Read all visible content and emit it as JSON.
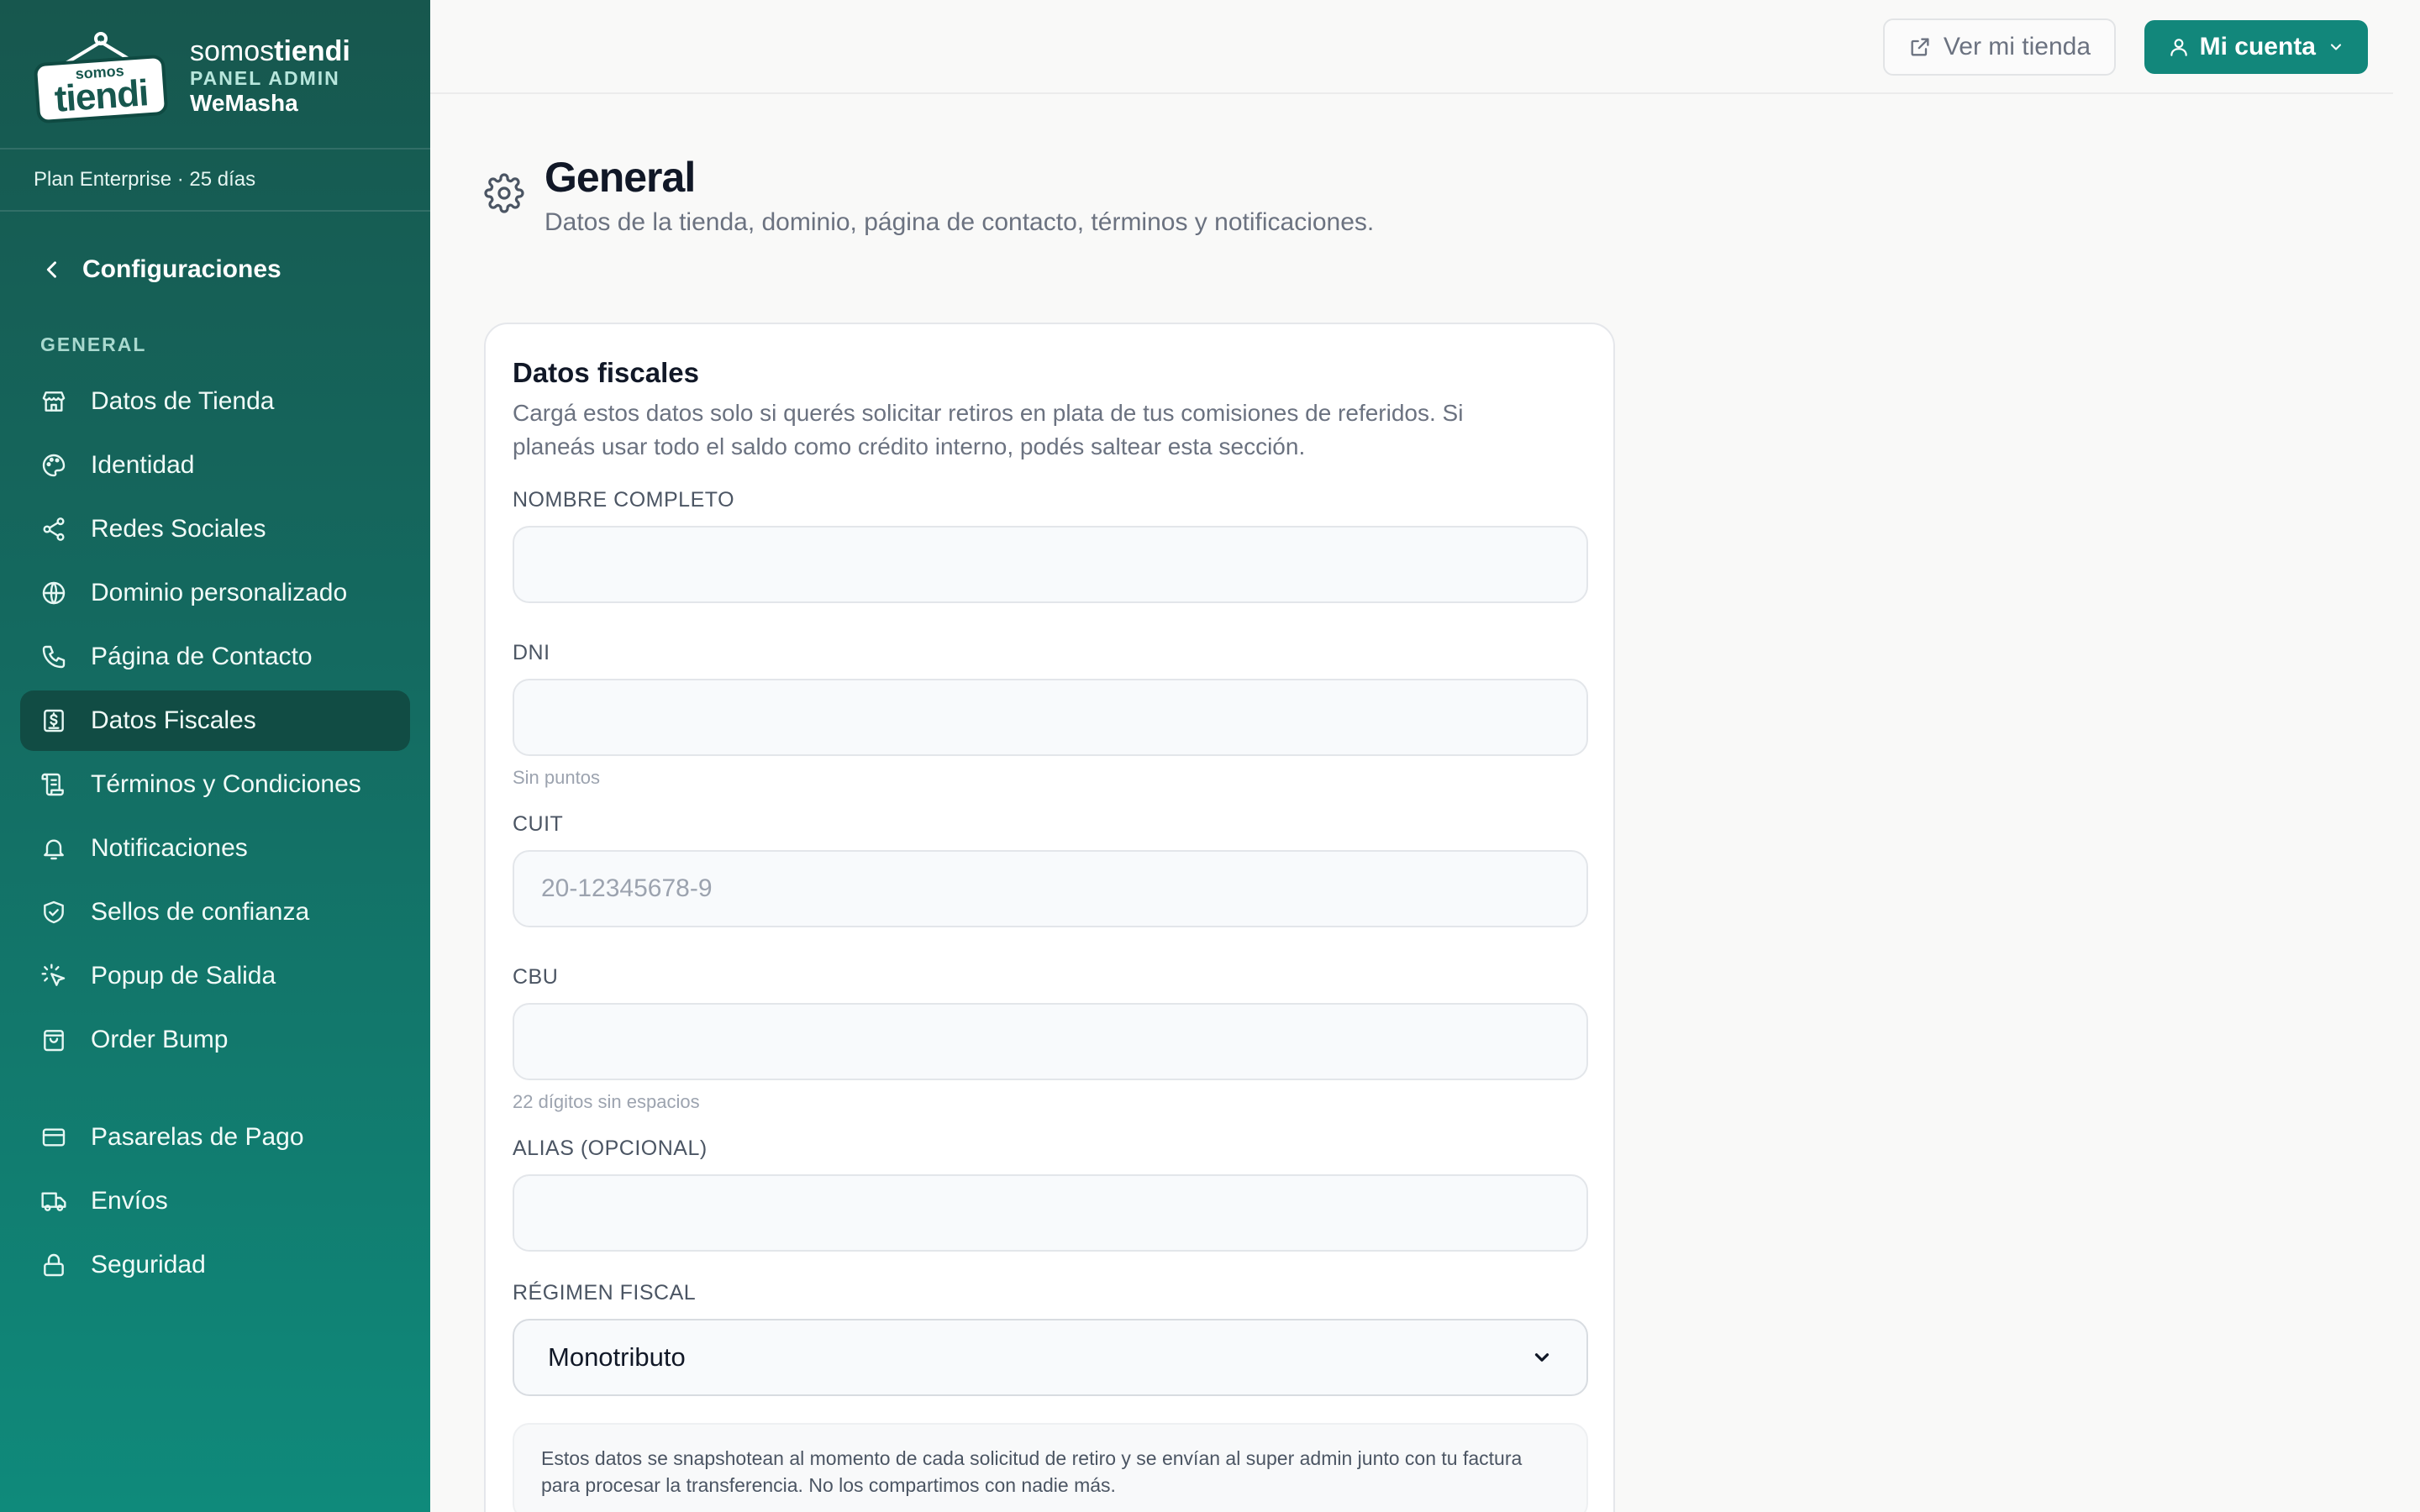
{
  "brand": {
    "logo_small": "somos",
    "logo_big": "tiendi",
    "name_light": "somos",
    "name_bold": "tiendi",
    "panel": "PANEL ADMIN",
    "store": "WeMasha"
  },
  "plan": "Plan Enterprise · 25 días",
  "sidebar": {
    "back_label": "Configuraciones",
    "section_label": "GENERAL",
    "items": [
      {
        "label": "Datos de Tienda",
        "icon": "store-icon"
      },
      {
        "label": "Identidad",
        "icon": "palette-icon"
      },
      {
        "label": "Redes Sociales",
        "icon": "share-icon"
      },
      {
        "label": "Dominio personalizado",
        "icon": "globe-icon"
      },
      {
        "label": "Página de Contacto",
        "icon": "phone-icon"
      },
      {
        "label": "Datos Fiscales",
        "icon": "receipt-icon",
        "active": true
      },
      {
        "label": "Términos y Condiciones",
        "icon": "scroll-icon"
      },
      {
        "label": "Notificaciones",
        "icon": "bell-icon"
      },
      {
        "label": "Sellos de confianza",
        "icon": "shield-check-icon"
      },
      {
        "label": "Popup de Salida",
        "icon": "pointer-click-icon"
      },
      {
        "label": "Order Bump",
        "icon": "shopping-bag-icon"
      }
    ],
    "items2": [
      {
        "label": "Pasarelas de Pago",
        "icon": "credit-card-icon"
      },
      {
        "label": "Envíos",
        "icon": "truck-icon"
      },
      {
        "label": "Seguridad",
        "icon": "lock-icon"
      }
    ]
  },
  "topbar": {
    "view_store": "Ver mi tienda",
    "account": "Mi cuenta"
  },
  "page": {
    "title": "General",
    "subtitle": "Datos de la tienda, dominio, página de contacto, términos y notificaciones."
  },
  "card": {
    "title": "Datos fiscales",
    "description": "Cargá estos datos solo si querés solicitar retiros en plata de tus comisiones de referidos. Si planeás usar todo el saldo como crédito interno, podés saltear esta sección.",
    "fields": {
      "name": {
        "label": "NOMBRE COMPLETO",
        "value": "",
        "placeholder": ""
      },
      "dni": {
        "label": "DNI",
        "value": "",
        "placeholder": "",
        "hint": "Sin puntos"
      },
      "cuit": {
        "label": "CUIT",
        "value": "",
        "placeholder": "20-12345678-9"
      },
      "cbu": {
        "label": "CBU",
        "value": "",
        "placeholder": "",
        "hint": "22 dígitos sin espacios"
      },
      "alias": {
        "label": "ALIAS (OPCIONAL)",
        "value": "",
        "placeholder": ""
      },
      "regime": {
        "label": "RÉGIMEN FISCAL",
        "selected": "Monotributo"
      }
    },
    "note": "Estos datos se snapshotean al momento de cada solicitud de retiro y se envían al super admin junto con tu factura para procesar la transferencia. No los compartimos con nadie más."
  },
  "colors": {
    "primary": "#12877b",
    "sidebar_top": "#17574e",
    "sidebar_bottom": "#0f8a7b",
    "active_item": "#114c44"
  }
}
